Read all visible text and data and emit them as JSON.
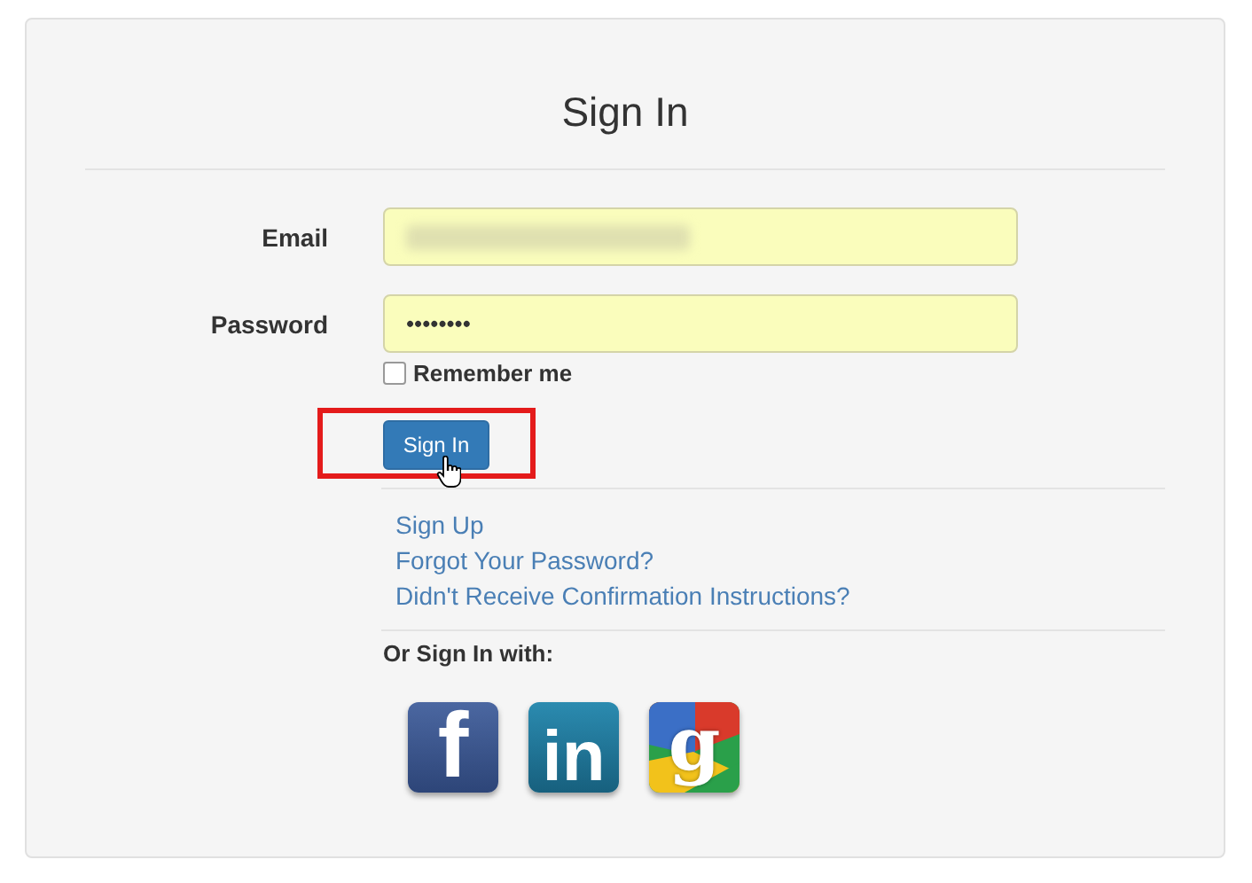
{
  "title": "Sign In",
  "fields": [
    {
      "label": "Email",
      "kind": "blurred"
    },
    {
      "label": "Password",
      "kind": "password",
      "value": "••••••••"
    }
  ],
  "remember": {
    "label": "Remember me",
    "checked": false
  },
  "submit": {
    "label": "Sign In",
    "highlighted": true
  },
  "links": [
    "Sign Up",
    "Forgot Your Password?",
    "Didn't Receive Confirmation Instructions?"
  ],
  "social": {
    "heading": "Or Sign In with:",
    "providers": [
      {
        "kind": "facebook",
        "label": "f"
      },
      {
        "kind": "linkedin",
        "label": "in"
      },
      {
        "kind": "google",
        "label": "g"
      }
    ]
  }
}
